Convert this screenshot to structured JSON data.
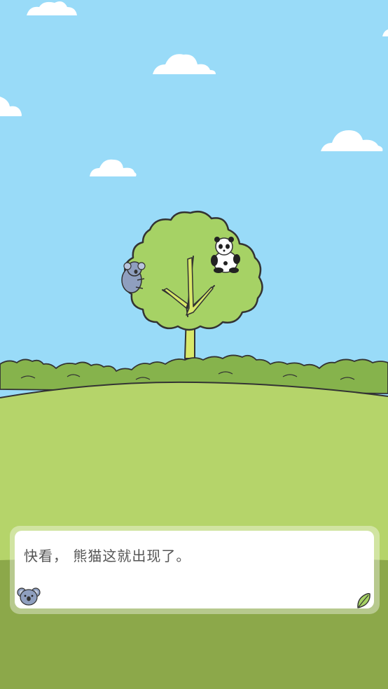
{
  "dialog": {
    "text": "快看， 熊猫这就出现了。"
  },
  "icons": {
    "speaker": "koala-avatar-icon",
    "advance": "leaf-next-icon"
  },
  "colors": {
    "sky": "#99dbf8",
    "bush": "#86b34c",
    "hill": "#b5d46a",
    "foreground": "#8ca84a",
    "tree_canopy": "#a6d265",
    "outline": "#333333"
  }
}
